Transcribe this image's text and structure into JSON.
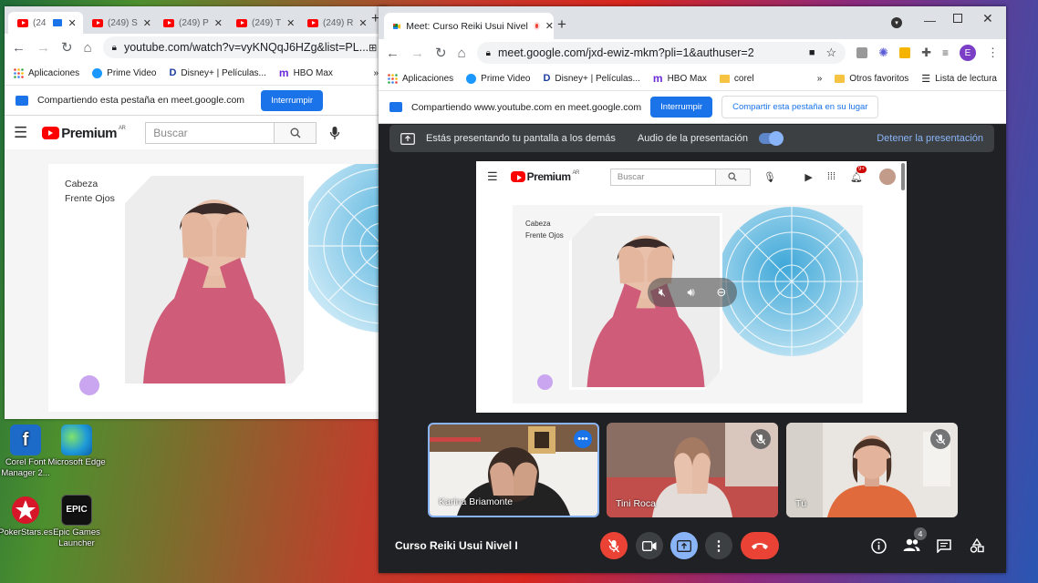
{
  "desktop": {
    "icons": [
      {
        "label": "Corel Font Manager 2...",
        "icon": "corel-font-manager-icon",
        "glyph": "f"
      },
      {
        "label": "Microsoft Edge",
        "icon": "edge-icon"
      },
      {
        "label": "PokerStars.es",
        "icon": "pokerstars-icon"
      },
      {
        "label": "Epic Games Launcher",
        "icon": "epic-games-icon",
        "glyph": "EPIC"
      }
    ]
  },
  "left_browser": {
    "tabs": [
      "(24",
      "(249) S",
      "(249) P",
      "(249) T",
      "(249) R"
    ],
    "url": "youtube.com/watch?v=vyKNQqJ6HZg&list=PL...",
    "bookmarks": [
      "Aplicaciones",
      "Prime Video",
      "Disney+ | Películas...",
      "HBO Max",
      "»"
    ],
    "share_text": "Compartiendo esta pestaña en meet.google.com",
    "share_button": "Interrumpir",
    "yt_logo": "Premium",
    "yt_region": "AR",
    "search_placeholder": "Buscar",
    "slide_text_1": "Cabeza",
    "slide_text_2": "Frente Ojos"
  },
  "meet": {
    "tab_title": "Meet: Curso Reiki Usui Nivel",
    "url": "meet.google.com/jxd-ewiz-mkm?pli=1&authuser=2",
    "profile_letter": "E",
    "bookmarks": [
      "Aplicaciones",
      "Prime Video",
      "Disney+ | Películas...",
      "HBO Max",
      "corel",
      "»",
      "Otros favoritos",
      "Lista de lectura"
    ],
    "share_text": "Compartiendo www.youtube.com en meet.google.com",
    "share_button": "Interrumpir",
    "share_alt_button": "Compartir esta pestaña en su lugar",
    "present_text": "Estás presentando tu pantalla a los demás",
    "audio_text": "Audio de la presentación",
    "stop_text": "Detener la presentación",
    "inner_yt_logo": "Premium",
    "inner_yt_region": "AR",
    "inner_search": "Buscar",
    "notification_badge": "9+",
    "inner_slide_text_1": "Cabeza",
    "inner_slide_text_2": "Frente Ojos",
    "participants": [
      {
        "name": "Karina Briamonte"
      },
      {
        "name": "Tini Roca"
      },
      {
        "name": "Tú"
      }
    ],
    "meeting_title": "Curso Reiki Usui Nivel I",
    "people_count": "4",
    "colors": {
      "end_call": "#ea4335",
      "accent": "#8ab4f8",
      "present": "#8ab4f8"
    }
  }
}
